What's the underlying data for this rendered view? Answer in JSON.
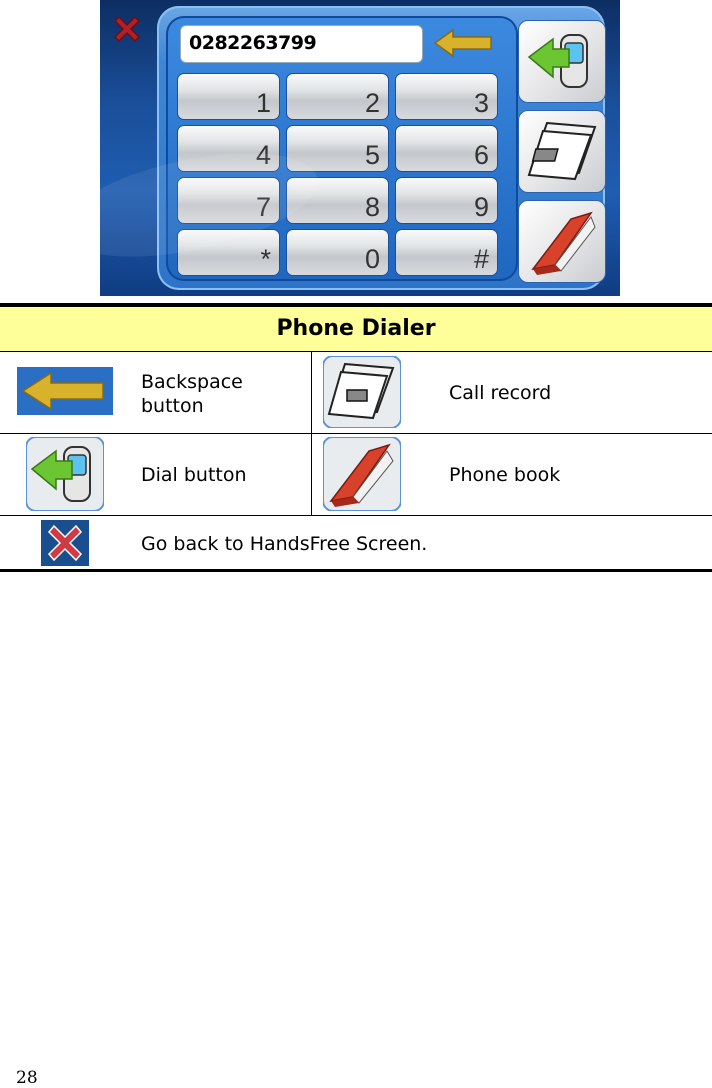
{
  "dialer": {
    "number": "0282263799",
    "keys": [
      "1",
      "2",
      "3",
      "4",
      "5",
      "6",
      "7",
      "8",
      "9",
      "*",
      "0",
      "#"
    ],
    "icons": {
      "close": "close-x-icon",
      "backspace": "arrow-left-icon",
      "dial": "dial-phone-icon",
      "call_record": "call-record-icon",
      "phone_book": "phone-book-icon"
    }
  },
  "table": {
    "title": "Phone Dialer",
    "rows": [
      {
        "left": {
          "icon": "arrow-left-icon",
          "label": "Backspace button"
        },
        "right": {
          "icon": "call-record-icon",
          "label": "Call record"
        }
      },
      {
        "left": {
          "icon": "dial-phone-icon",
          "label": "Dial button"
        },
        "right": {
          "icon": "phone-book-icon",
          "label": "Phone book"
        }
      },
      {
        "full": {
          "icon": "close-x-icon",
          "label": "Go back to HandsFree Screen."
        }
      }
    ]
  },
  "page_number": "28"
}
